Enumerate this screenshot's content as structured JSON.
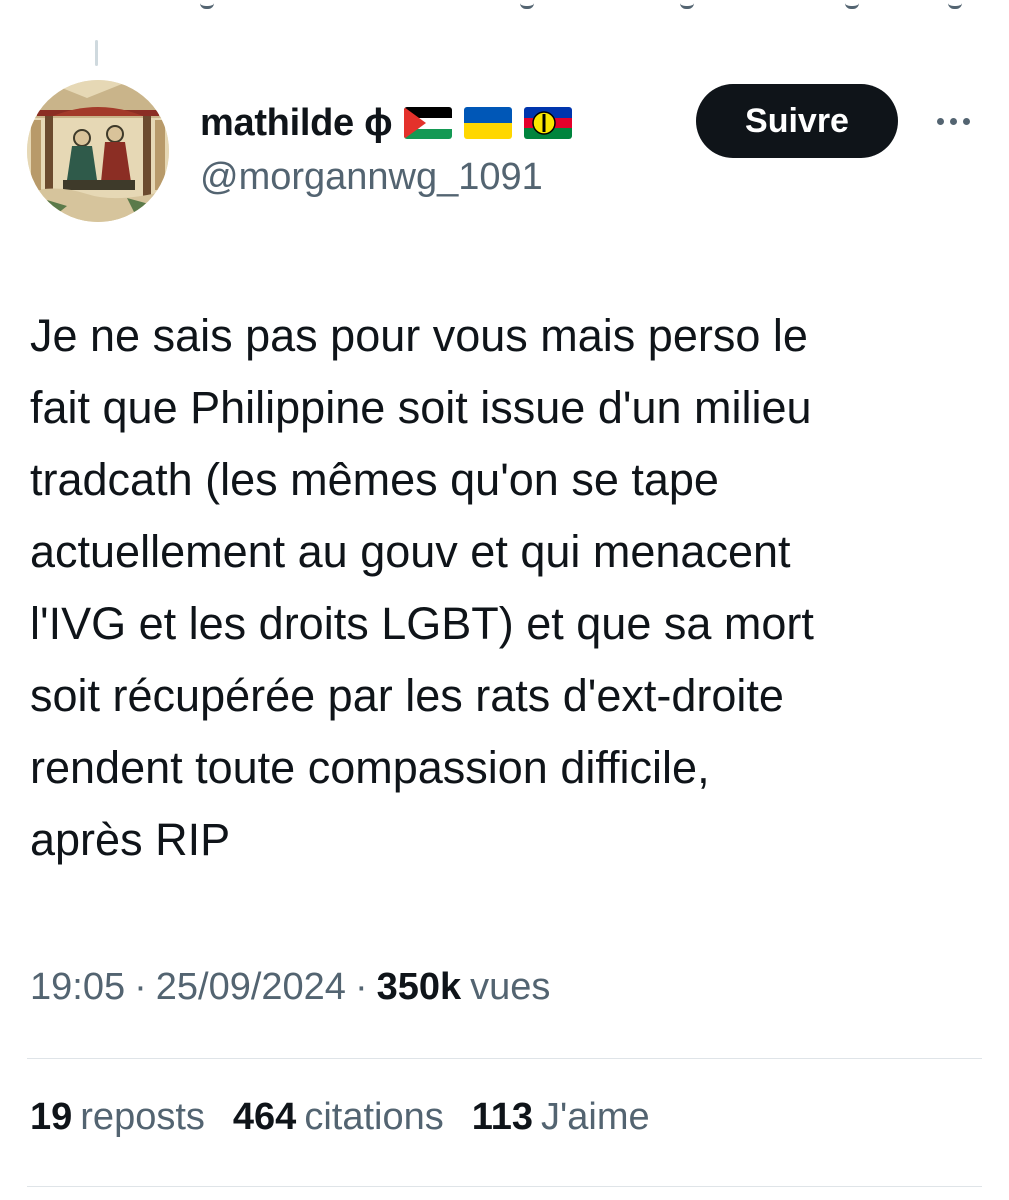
{
  "user": {
    "display_name": "mathilde ɸ",
    "handle": "@morgannwg_1091",
    "flags": [
      "palestine-flag-icon",
      "ukraine-flag-icon",
      "new-caledonia-flag-icon"
    ]
  },
  "actions": {
    "follow_label": "Suivre",
    "more_icon": "more-dots-icon"
  },
  "tweet": {
    "lines": [
      "Je ne sais pas pour vous mais perso le",
      "fait que Philippine soit issue d'un milieu",
      "tradcath (les mêmes qu'on se tape",
      "actuellement au gouv et qui menacent",
      "l'IVG et les droits LGBT) et que sa mort",
      "soit récupérée par les rats d'ext-droite",
      "rendent toute compassion difficile,",
      "après RIP"
    ]
  },
  "meta": {
    "time": "19:05",
    "date": "25/09/2024",
    "views_count": "350k",
    "views_label": "vues"
  },
  "stats": {
    "reposts_count": "19",
    "reposts_label": "reposts",
    "quotes_count": "464",
    "quotes_label": "citations",
    "likes_count": "113",
    "likes_label": "J'aime"
  },
  "colors": {
    "text": "#0f1419",
    "secondary": "#536471",
    "button_bg": "#0f1419",
    "button_text": "#ffffff",
    "divider": "#dfe4e8"
  }
}
